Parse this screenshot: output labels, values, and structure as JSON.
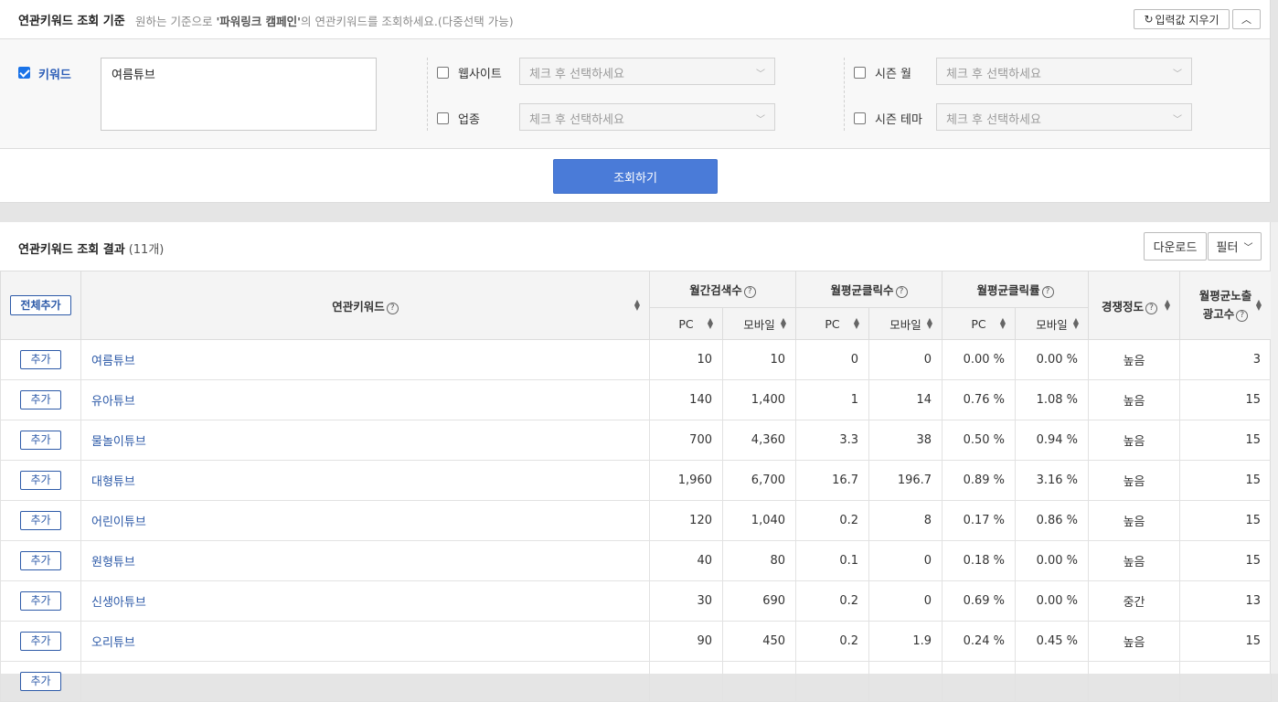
{
  "criteria": {
    "title": "연관키워드 조회 기준",
    "desc_prefix": "원하는 기준으로 ",
    "desc_bold": "'파워링크 캠페인'",
    "desc_suffix": "의 연관키워드를 조회하세요.(다중선택 가능)",
    "clear_label": "입력값 지우기",
    "keyword_label": "키워드",
    "keyword_value": "여름튜브",
    "website_label": "웹사이트",
    "industry_label": "업종",
    "season_month_label": "시즌 월",
    "season_theme_label": "시즌 테마",
    "select_placeholder": "체크 후 선택하세요",
    "search_button": "조회하기"
  },
  "results": {
    "title": "연관키워드 조회 결과",
    "count": "(11개)",
    "download_label": "다운로드",
    "filter_label": "필터",
    "headers": {
      "add_all": "전체추가",
      "keyword": "연관키워드",
      "monthly_search": "월간검색수",
      "avg_clicks": "월평균클릭수",
      "avg_ctr": "월평균클릭률",
      "competition": "경쟁정도",
      "avg_ads_line1": "월평균노출",
      "avg_ads_line2": "광고수",
      "pc": "PC",
      "mobile": "모바일"
    },
    "add_label": "추가",
    "rows": [
      {
        "keyword": "여름튜브",
        "search_pc": "10",
        "search_mobile": "10",
        "click_pc": "0",
        "click_mobile": "0",
        "ctr_pc": "0.00 %",
        "ctr_mobile": "0.00 %",
        "competition": "높음",
        "ads": "3"
      },
      {
        "keyword": "유아튜브",
        "search_pc": "140",
        "search_mobile": "1,400",
        "click_pc": "1",
        "click_mobile": "14",
        "ctr_pc": "0.76 %",
        "ctr_mobile": "1.08 %",
        "competition": "높음",
        "ads": "15"
      },
      {
        "keyword": "물놀이튜브",
        "search_pc": "700",
        "search_mobile": "4,360",
        "click_pc": "3.3",
        "click_mobile": "38",
        "ctr_pc": "0.50 %",
        "ctr_mobile": "0.94 %",
        "competition": "높음",
        "ads": "15"
      },
      {
        "keyword": "대형튜브",
        "search_pc": "1,960",
        "search_mobile": "6,700",
        "click_pc": "16.7",
        "click_mobile": "196.7",
        "ctr_pc": "0.89 %",
        "ctr_mobile": "3.16 %",
        "competition": "높음",
        "ads": "15"
      },
      {
        "keyword": "어린이튜브",
        "search_pc": "120",
        "search_mobile": "1,040",
        "click_pc": "0.2",
        "click_mobile": "8",
        "ctr_pc": "0.17 %",
        "ctr_mobile": "0.86 %",
        "competition": "높음",
        "ads": "15"
      },
      {
        "keyword": "원형튜브",
        "search_pc": "40",
        "search_mobile": "80",
        "click_pc": "0.1",
        "click_mobile": "0",
        "ctr_pc": "0.18 %",
        "ctr_mobile": "0.00 %",
        "competition": "높음",
        "ads": "15"
      },
      {
        "keyword": "신생아튜브",
        "search_pc": "30",
        "search_mobile": "690",
        "click_pc": "0.2",
        "click_mobile": "0",
        "ctr_pc": "0.69 %",
        "ctr_mobile": "0.00 %",
        "competition": "중간",
        "ads": "13"
      },
      {
        "keyword": "오리튜브",
        "search_pc": "90",
        "search_mobile": "450",
        "click_pc": "0.2",
        "click_mobile": "1.9",
        "ctr_pc": "0.24 %",
        "ctr_mobile": "0.45 %",
        "competition": "높음",
        "ads": "15"
      },
      {
        "keyword": "",
        "search_pc": "",
        "search_mobile": "",
        "click_pc": "",
        "click_mobile": "",
        "ctr_pc": "",
        "ctr_mobile": "",
        "competition": "",
        "ads": ""
      }
    ]
  },
  "icons": {
    "refresh": "refresh-icon",
    "collapse": "chevron-up-icon",
    "filter_caret": "chevron-down-icon",
    "help": "question-circle-icon",
    "sort": "sort-icon"
  },
  "colors": {
    "accent": "#4a7bd8",
    "link": "#2d5aa8",
    "checkbox": "#1a73e8"
  }
}
